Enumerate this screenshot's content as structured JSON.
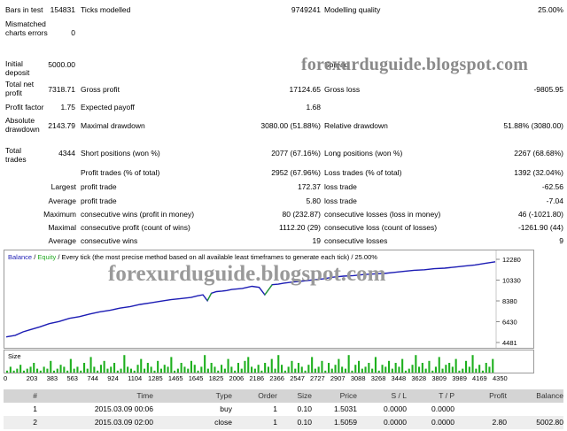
{
  "stats": {
    "bars_in_test": {
      "label": "Bars in test",
      "value": "154831"
    },
    "ticks_modelled": {
      "label": "Ticks modelled",
      "value": "9749241"
    },
    "modelling_quality": {
      "label": "Modelling quality",
      "value": "25.00%"
    },
    "mismatched": {
      "label": "Mismatched charts errors",
      "value": "0"
    },
    "initial_deposit": {
      "label": "Initial deposit",
      "value": "5000.00"
    },
    "spread": {
      "label": "Spread",
      "value": ""
    },
    "total_net_profit": {
      "label": "Total net profit",
      "value": "7318.71"
    },
    "gross_profit": {
      "label": "Gross profit",
      "value": "17124.65"
    },
    "gross_loss": {
      "label": "Gross loss",
      "value": "-9805.95"
    },
    "profit_factor": {
      "label": "Profit factor",
      "value": "1.75"
    },
    "expected_payoff": {
      "label": "Expected payoff",
      "value": "1.68"
    },
    "absolute_drawdown": {
      "label": "Absolute drawdown",
      "value": "2143.79"
    },
    "maximal_drawdown": {
      "label": "Maximal drawdown",
      "value": "3080.00 (51.88%)"
    },
    "relative_drawdown": {
      "label": "Relative drawdown",
      "value": "51.88% (3080.00)"
    },
    "total_trades": {
      "label": "Total trades",
      "value": "4344"
    },
    "short_positions": {
      "label": "Short positions (won %)",
      "value": "2077 (67.16%)"
    },
    "long_positions": {
      "label": "Long positions (won %)",
      "value": "2267 (68.68%)"
    },
    "profit_trades": {
      "label": "Profit trades (% of total)",
      "value": "2952 (67.96%)"
    },
    "loss_trades": {
      "label": "Loss trades (% of total)",
      "value": "1392 (32.04%)"
    },
    "largest": {
      "label": "Largest",
      "profit_label": "profit trade",
      "profit_value": "172.37",
      "loss_label": "loss trade",
      "loss_value": "-62.56"
    },
    "average": {
      "label": "Average",
      "profit_label": "profit trade",
      "profit_value": "5.80",
      "loss_label": "loss trade",
      "loss_value": "-7.04"
    },
    "maximum": {
      "label": "Maximum",
      "wins_label": "consecutive wins (profit in money)",
      "wins_value": "80 (232.87)",
      "losses_label": "consecutive losses (loss in money)",
      "losses_value": "46 (-1021.80)"
    },
    "maximal": {
      "label": "Maximal",
      "wins_label": "consecutive profit (count of wins)",
      "wins_value": "1112.20 (29)",
      "losses_label": "consecutive loss (count of losses)",
      "losses_value": "-1261.90 (44)"
    },
    "average_consec": {
      "label": "Average",
      "wins_label": "consecutive wins",
      "wins_value": "19",
      "losses_label": "consecutive losses",
      "losses_value": "9"
    }
  },
  "watermark": "forexurduguide.blogspot.com",
  "chart_header": {
    "balance": "Balance",
    "sep1": " / ",
    "equity": "Equity",
    "sep2": " / ",
    "desc": "Every tick (the most precise method based on all available least timeframes to generate each tick) / 25.00%"
  },
  "size_label": "Size",
  "chart_data": {
    "type": "line",
    "x_ticks": [
      "0",
      "203",
      "383",
      "563",
      "744",
      "924",
      "1104",
      "1285",
      "1465",
      "1645",
      "1825",
      "2006",
      "2186",
      "2366",
      "2547",
      "2727",
      "2907",
      "3088",
      "3268",
      "3448",
      "3628",
      "3809",
      "3989",
      "4169",
      "4350"
    ],
    "y_ticks": [
      "12280",
      "10330",
      "8380",
      "6430",
      "4481"
    ],
    "xlim": [
      0,
      4350
    ],
    "ylim": [
      4481,
      12280
    ],
    "series": [
      {
        "name": "Balance",
        "color": "#1c1cb4",
        "x": [
          0,
          80,
          150,
          203,
          300,
          383,
          470,
          563,
          650,
          744,
          830,
          924,
          1010,
          1104,
          1190,
          1285,
          1370,
          1465,
          1550,
          1645,
          1700,
          1750,
          1790,
          1825,
          1870,
          1920,
          1960,
          2006,
          2100,
          2186,
          2250,
          2300,
          2366,
          2420,
          2470,
          2547,
          2640,
          2727,
          2820,
          2907,
          3000,
          3088,
          3180,
          3268,
          3360,
          3448,
          3540,
          3628,
          3720,
          3809,
          3900,
          3989,
          4080,
          4169,
          4260,
          4350
        ],
        "y": [
          5000,
          5150,
          5480,
          5650,
          5950,
          6250,
          6450,
          6750,
          6900,
          7150,
          7350,
          7500,
          7700,
          7850,
          8050,
          8200,
          8350,
          8500,
          8600,
          8700,
          8850,
          8950,
          8400,
          9100,
          9250,
          9300,
          9350,
          9450,
          9550,
          9750,
          9650,
          8950,
          9900,
          9950,
          10050,
          10150,
          10250,
          10350,
          10450,
          10600,
          10700,
          10750,
          10850,
          10900,
          10950,
          11050,
          11150,
          11250,
          11300,
          11400,
          11450,
          11550,
          11650,
          11750,
          11900,
          12050
        ]
      },
      {
        "name": "Equity",
        "color": "#22aa22",
        "segments": [
          [
            1825,
            9100
          ],
          [
            1790,
            8400
          ],
          [
            2366,
            9900
          ],
          [
            2300,
            8950
          ]
        ]
      }
    ],
    "size_bars": [
      1,
      3,
      1,
      2,
      4,
      1,
      2,
      3,
      5,
      2,
      1,
      3,
      2,
      6,
      1,
      2,
      4,
      3,
      1,
      7,
      2,
      3,
      1,
      5,
      2,
      8,
      3,
      1,
      4,
      6,
      2,
      3,
      5,
      1,
      2,
      9,
      3,
      2,
      1,
      4,
      7,
      2,
      5,
      3,
      1,
      6,
      2,
      4,
      3,
      8,
      1,
      2,
      5,
      3,
      2,
      6,
      4,
      1,
      3,
      9,
      2,
      5,
      3,
      1,
      4,
      2,
      7,
      3,
      1,
      5,
      2,
      6,
      8,
      3,
      2,
      4,
      1,
      5,
      3,
      7,
      2,
      9,
      4,
      1,
      3,
      6,
      2,
      5,
      3,
      1,
      4,
      8,
      2,
      3,
      6,
      1,
      5,
      2,
      4,
      7,
      3,
      2,
      9,
      1,
      4,
      6,
      2,
      3,
      5,
      2,
      8,
      1,
      4,
      3,
      6,
      2,
      5,
      3,
      7,
      1,
      2,
      4,
      9,
      3,
      5,
      2,
      6,
      1,
      3,
      8,
      2,
      4,
      5,
      3,
      7,
      1,
      2,
      6,
      3,
      9,
      2,
      4,
      1,
      5,
      3,
      7
    ]
  },
  "table": {
    "headers": [
      "#",
      "Time",
      "Type",
      "Order",
      "Size",
      "Price",
      "S / L",
      "T / P",
      "Profit",
      "Balance"
    ],
    "rows": [
      [
        "1",
        "2015.03.09 00:06",
        "buy",
        "1",
        "0.10",
        "1.5031",
        "0.0000",
        "0.0000",
        "",
        ""
      ],
      [
        "2",
        "2015.03.09 02:00",
        "close",
        "1",
        "0.10",
        "1.5059",
        "0.0000",
        "0.0000",
        "2.80",
        "5002.80"
      ]
    ]
  }
}
